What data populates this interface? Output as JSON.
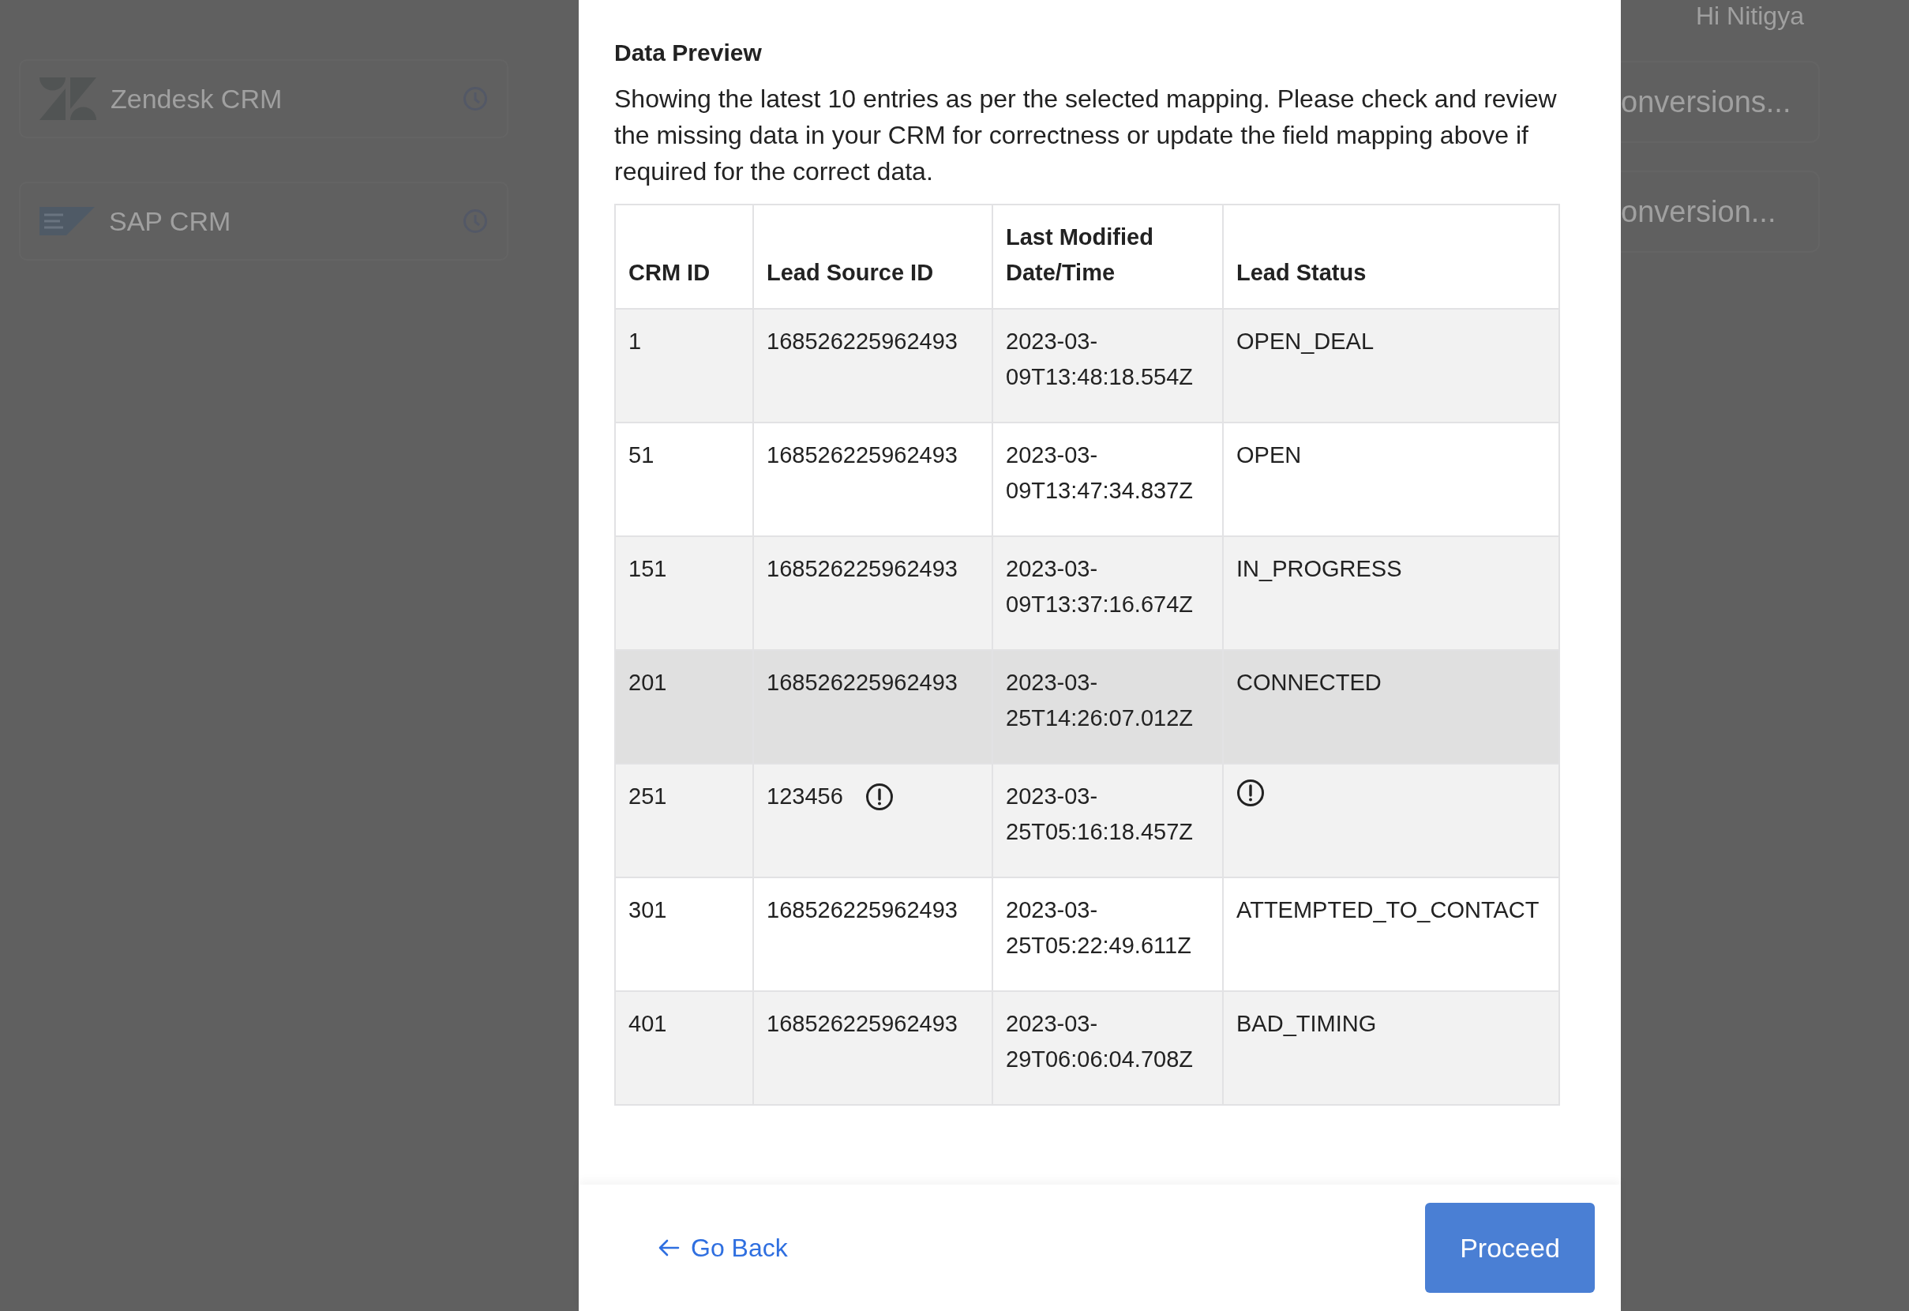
{
  "background": {
    "user_greeting": "Hi Nitigya",
    "crm_cards": [
      {
        "name": "Zendesk CRM",
        "kind": "zendesk"
      },
      {
        "name": "SAP CRM",
        "kind": "sap"
      }
    ],
    "right_cards": [
      {
        "text": "onversions..."
      },
      {
        "text": "onversion..."
      }
    ]
  },
  "dialog": {
    "title": "Data Preview",
    "description": "Showing the latest 10 entries as per the selected mapping. Please check and review the missing data in your CRM for correctness or update the field mapping above if required for the correct data.",
    "table": {
      "columns": [
        "CRM ID",
        "Lead Source ID",
        "Last Modified Date/Time",
        "Lead Status"
      ],
      "rows": [
        {
          "shaded": true,
          "hovered": false,
          "cells": [
            {
              "text": "1",
              "warning": false
            },
            {
              "text": "168526225962493",
              "warning": false
            },
            {
              "text": "2023-03-09T13:48:18.554Z",
              "warning": false
            },
            {
              "text": "OPEN_DEAL",
              "warning": false
            }
          ]
        },
        {
          "shaded": false,
          "hovered": false,
          "cells": [
            {
              "text": "51",
              "warning": false
            },
            {
              "text": "168526225962493",
              "warning": false
            },
            {
              "text": "2023-03-09T13:47:34.837Z",
              "warning": false
            },
            {
              "text": "OPEN",
              "warning": false
            }
          ]
        },
        {
          "shaded": true,
          "hovered": false,
          "cells": [
            {
              "text": "151",
              "warning": false
            },
            {
              "text": "168526225962493",
              "warning": false
            },
            {
              "text": "2023-03-09T13:37:16.674Z",
              "warning": false
            },
            {
              "text": "IN_PROGRESS",
              "warning": false
            }
          ]
        },
        {
          "shaded": true,
          "hovered": true,
          "cells": [
            {
              "text": "201",
              "warning": false
            },
            {
              "text": "168526225962493",
              "warning": false
            },
            {
              "text": "2023-03-25T14:26:07.012Z",
              "warning": false
            },
            {
              "text": "CONNECTED",
              "warning": false
            }
          ]
        },
        {
          "shaded": true,
          "hovered": false,
          "cells": [
            {
              "text": "251",
              "warning": false
            },
            {
              "text": "123456",
              "warning": true
            },
            {
              "text": "2023-03-25T05:16:18.457Z",
              "warning": false
            },
            {
              "warning": true
            }
          ]
        },
        {
          "shaded": false,
          "hovered": false,
          "cells": [
            {
              "text": "301",
              "warning": false
            },
            {
              "text": "168526225962493",
              "warning": false
            },
            {
              "text": "2023-03-25T05:22:49.611Z",
              "warning": false
            },
            {
              "text": "ATTEMPTED_TO_CONTACT",
              "warning": false
            }
          ]
        },
        {
          "shaded": true,
          "hovered": false,
          "cells": [
            {
              "text": "401",
              "warning": false
            },
            {
              "text": "168526225962493",
              "warning": false
            },
            {
              "text": "2023-03-29T06:06:04.708Z",
              "warning": false
            },
            {
              "text": "BAD_TIMING",
              "warning": false
            }
          ]
        }
      ]
    }
  },
  "footer": {
    "back_label": "Go Back",
    "proceed_label": "Proceed"
  }
}
